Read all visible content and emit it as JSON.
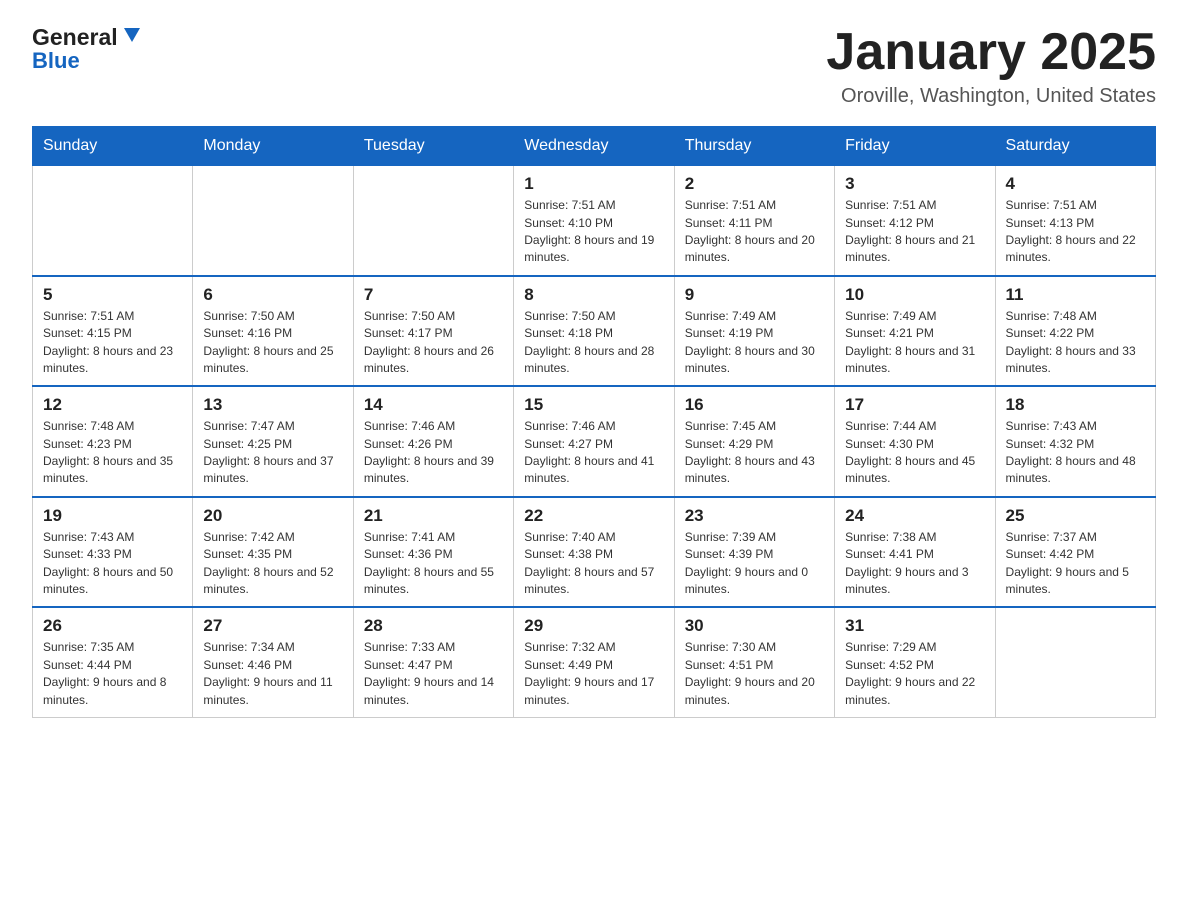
{
  "header": {
    "logo_general": "General",
    "logo_blue": "Blue",
    "month_title": "January 2025",
    "location": "Oroville, Washington, United States"
  },
  "days_of_week": [
    "Sunday",
    "Monday",
    "Tuesday",
    "Wednesday",
    "Thursday",
    "Friday",
    "Saturday"
  ],
  "weeks": [
    [
      {
        "day": "",
        "sunrise": "",
        "sunset": "",
        "daylight": ""
      },
      {
        "day": "",
        "sunrise": "",
        "sunset": "",
        "daylight": ""
      },
      {
        "day": "",
        "sunrise": "",
        "sunset": "",
        "daylight": ""
      },
      {
        "day": "1",
        "sunrise": "Sunrise: 7:51 AM",
        "sunset": "Sunset: 4:10 PM",
        "daylight": "Daylight: 8 hours and 19 minutes."
      },
      {
        "day": "2",
        "sunrise": "Sunrise: 7:51 AM",
        "sunset": "Sunset: 4:11 PM",
        "daylight": "Daylight: 8 hours and 20 minutes."
      },
      {
        "day": "3",
        "sunrise": "Sunrise: 7:51 AM",
        "sunset": "Sunset: 4:12 PM",
        "daylight": "Daylight: 8 hours and 21 minutes."
      },
      {
        "day": "4",
        "sunrise": "Sunrise: 7:51 AM",
        "sunset": "Sunset: 4:13 PM",
        "daylight": "Daylight: 8 hours and 22 minutes."
      }
    ],
    [
      {
        "day": "5",
        "sunrise": "Sunrise: 7:51 AM",
        "sunset": "Sunset: 4:15 PM",
        "daylight": "Daylight: 8 hours and 23 minutes."
      },
      {
        "day": "6",
        "sunrise": "Sunrise: 7:50 AM",
        "sunset": "Sunset: 4:16 PM",
        "daylight": "Daylight: 8 hours and 25 minutes."
      },
      {
        "day": "7",
        "sunrise": "Sunrise: 7:50 AM",
        "sunset": "Sunset: 4:17 PM",
        "daylight": "Daylight: 8 hours and 26 minutes."
      },
      {
        "day": "8",
        "sunrise": "Sunrise: 7:50 AM",
        "sunset": "Sunset: 4:18 PM",
        "daylight": "Daylight: 8 hours and 28 minutes."
      },
      {
        "day": "9",
        "sunrise": "Sunrise: 7:49 AM",
        "sunset": "Sunset: 4:19 PM",
        "daylight": "Daylight: 8 hours and 30 minutes."
      },
      {
        "day": "10",
        "sunrise": "Sunrise: 7:49 AM",
        "sunset": "Sunset: 4:21 PM",
        "daylight": "Daylight: 8 hours and 31 minutes."
      },
      {
        "day": "11",
        "sunrise": "Sunrise: 7:48 AM",
        "sunset": "Sunset: 4:22 PM",
        "daylight": "Daylight: 8 hours and 33 minutes."
      }
    ],
    [
      {
        "day": "12",
        "sunrise": "Sunrise: 7:48 AM",
        "sunset": "Sunset: 4:23 PM",
        "daylight": "Daylight: 8 hours and 35 minutes."
      },
      {
        "day": "13",
        "sunrise": "Sunrise: 7:47 AM",
        "sunset": "Sunset: 4:25 PM",
        "daylight": "Daylight: 8 hours and 37 minutes."
      },
      {
        "day": "14",
        "sunrise": "Sunrise: 7:46 AM",
        "sunset": "Sunset: 4:26 PM",
        "daylight": "Daylight: 8 hours and 39 minutes."
      },
      {
        "day": "15",
        "sunrise": "Sunrise: 7:46 AM",
        "sunset": "Sunset: 4:27 PM",
        "daylight": "Daylight: 8 hours and 41 minutes."
      },
      {
        "day": "16",
        "sunrise": "Sunrise: 7:45 AM",
        "sunset": "Sunset: 4:29 PM",
        "daylight": "Daylight: 8 hours and 43 minutes."
      },
      {
        "day": "17",
        "sunrise": "Sunrise: 7:44 AM",
        "sunset": "Sunset: 4:30 PM",
        "daylight": "Daylight: 8 hours and 45 minutes."
      },
      {
        "day": "18",
        "sunrise": "Sunrise: 7:43 AM",
        "sunset": "Sunset: 4:32 PM",
        "daylight": "Daylight: 8 hours and 48 minutes."
      }
    ],
    [
      {
        "day": "19",
        "sunrise": "Sunrise: 7:43 AM",
        "sunset": "Sunset: 4:33 PM",
        "daylight": "Daylight: 8 hours and 50 minutes."
      },
      {
        "day": "20",
        "sunrise": "Sunrise: 7:42 AM",
        "sunset": "Sunset: 4:35 PM",
        "daylight": "Daylight: 8 hours and 52 minutes."
      },
      {
        "day": "21",
        "sunrise": "Sunrise: 7:41 AM",
        "sunset": "Sunset: 4:36 PM",
        "daylight": "Daylight: 8 hours and 55 minutes."
      },
      {
        "day": "22",
        "sunrise": "Sunrise: 7:40 AM",
        "sunset": "Sunset: 4:38 PM",
        "daylight": "Daylight: 8 hours and 57 minutes."
      },
      {
        "day": "23",
        "sunrise": "Sunrise: 7:39 AM",
        "sunset": "Sunset: 4:39 PM",
        "daylight": "Daylight: 9 hours and 0 minutes."
      },
      {
        "day": "24",
        "sunrise": "Sunrise: 7:38 AM",
        "sunset": "Sunset: 4:41 PM",
        "daylight": "Daylight: 9 hours and 3 minutes."
      },
      {
        "day": "25",
        "sunrise": "Sunrise: 7:37 AM",
        "sunset": "Sunset: 4:42 PM",
        "daylight": "Daylight: 9 hours and 5 minutes."
      }
    ],
    [
      {
        "day": "26",
        "sunrise": "Sunrise: 7:35 AM",
        "sunset": "Sunset: 4:44 PM",
        "daylight": "Daylight: 9 hours and 8 minutes."
      },
      {
        "day": "27",
        "sunrise": "Sunrise: 7:34 AM",
        "sunset": "Sunset: 4:46 PM",
        "daylight": "Daylight: 9 hours and 11 minutes."
      },
      {
        "day": "28",
        "sunrise": "Sunrise: 7:33 AM",
        "sunset": "Sunset: 4:47 PM",
        "daylight": "Daylight: 9 hours and 14 minutes."
      },
      {
        "day": "29",
        "sunrise": "Sunrise: 7:32 AM",
        "sunset": "Sunset: 4:49 PM",
        "daylight": "Daylight: 9 hours and 17 minutes."
      },
      {
        "day": "30",
        "sunrise": "Sunrise: 7:30 AM",
        "sunset": "Sunset: 4:51 PM",
        "daylight": "Daylight: 9 hours and 20 minutes."
      },
      {
        "day": "31",
        "sunrise": "Sunrise: 7:29 AM",
        "sunset": "Sunset: 4:52 PM",
        "daylight": "Daylight: 9 hours and 22 minutes."
      },
      {
        "day": "",
        "sunrise": "",
        "sunset": "",
        "daylight": ""
      }
    ]
  ]
}
